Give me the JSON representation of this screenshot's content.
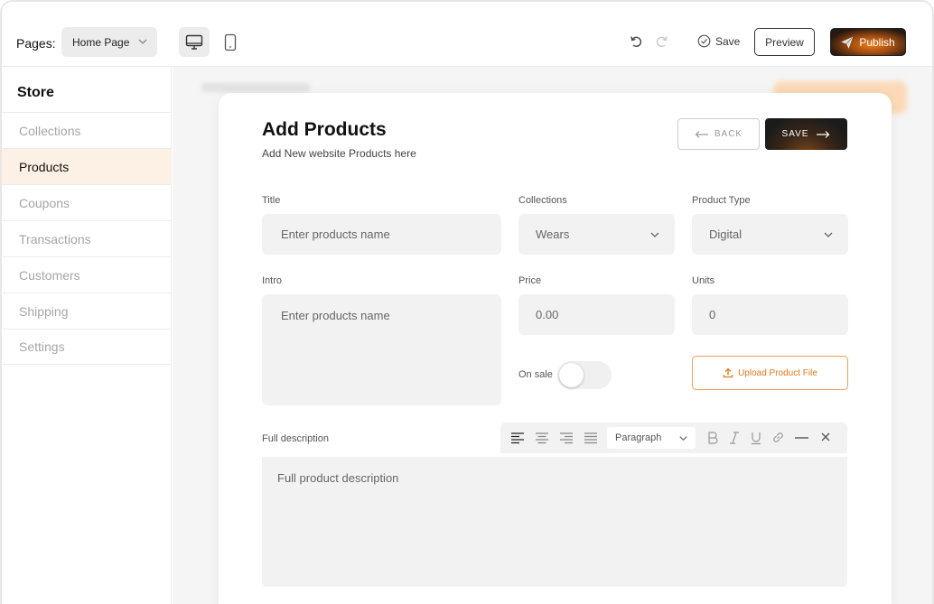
{
  "topbar": {
    "pages_label": "Pages:",
    "page_select_value": "Home Page",
    "save_label": "Save",
    "preview_label": "Preview",
    "publish_label": "Publish"
  },
  "sidebar": {
    "title": "Store",
    "items": [
      {
        "label": "Collections",
        "active": false
      },
      {
        "label": "Products",
        "active": true
      },
      {
        "label": "Coupons",
        "active": false
      },
      {
        "label": "Transactions",
        "active": false
      },
      {
        "label": "Customers",
        "active": false
      },
      {
        "label": "Shipping",
        "active": false
      },
      {
        "label": "Settings",
        "active": false
      }
    ]
  },
  "modal": {
    "title": "Add Products",
    "subtitle": "Add New website Products here",
    "back_label": "BACK",
    "save_label": "SAVE",
    "title_label": "Title",
    "title_placeholder": "Enter products name",
    "collections_label": "Collections",
    "collections_value": "Wears",
    "product_type_label": "Product Type",
    "product_type_value": "Digital",
    "intro_label": "Intro",
    "intro_placeholder": "Enter products name",
    "price_label": "Price",
    "price_value": "0.00",
    "units_label": "Units",
    "units_value": "0",
    "on_sale_label": "On sale",
    "on_sale_enabled": false,
    "upload_label": "Upload Product File",
    "full_description_label": "Full description",
    "full_description_placeholder": "Full product description",
    "paragraph_select": "Paragraph"
  },
  "colors": {
    "accent": "#f07d1a",
    "active_bg": "#fdf1e6",
    "dark": "#1b1b1b"
  }
}
